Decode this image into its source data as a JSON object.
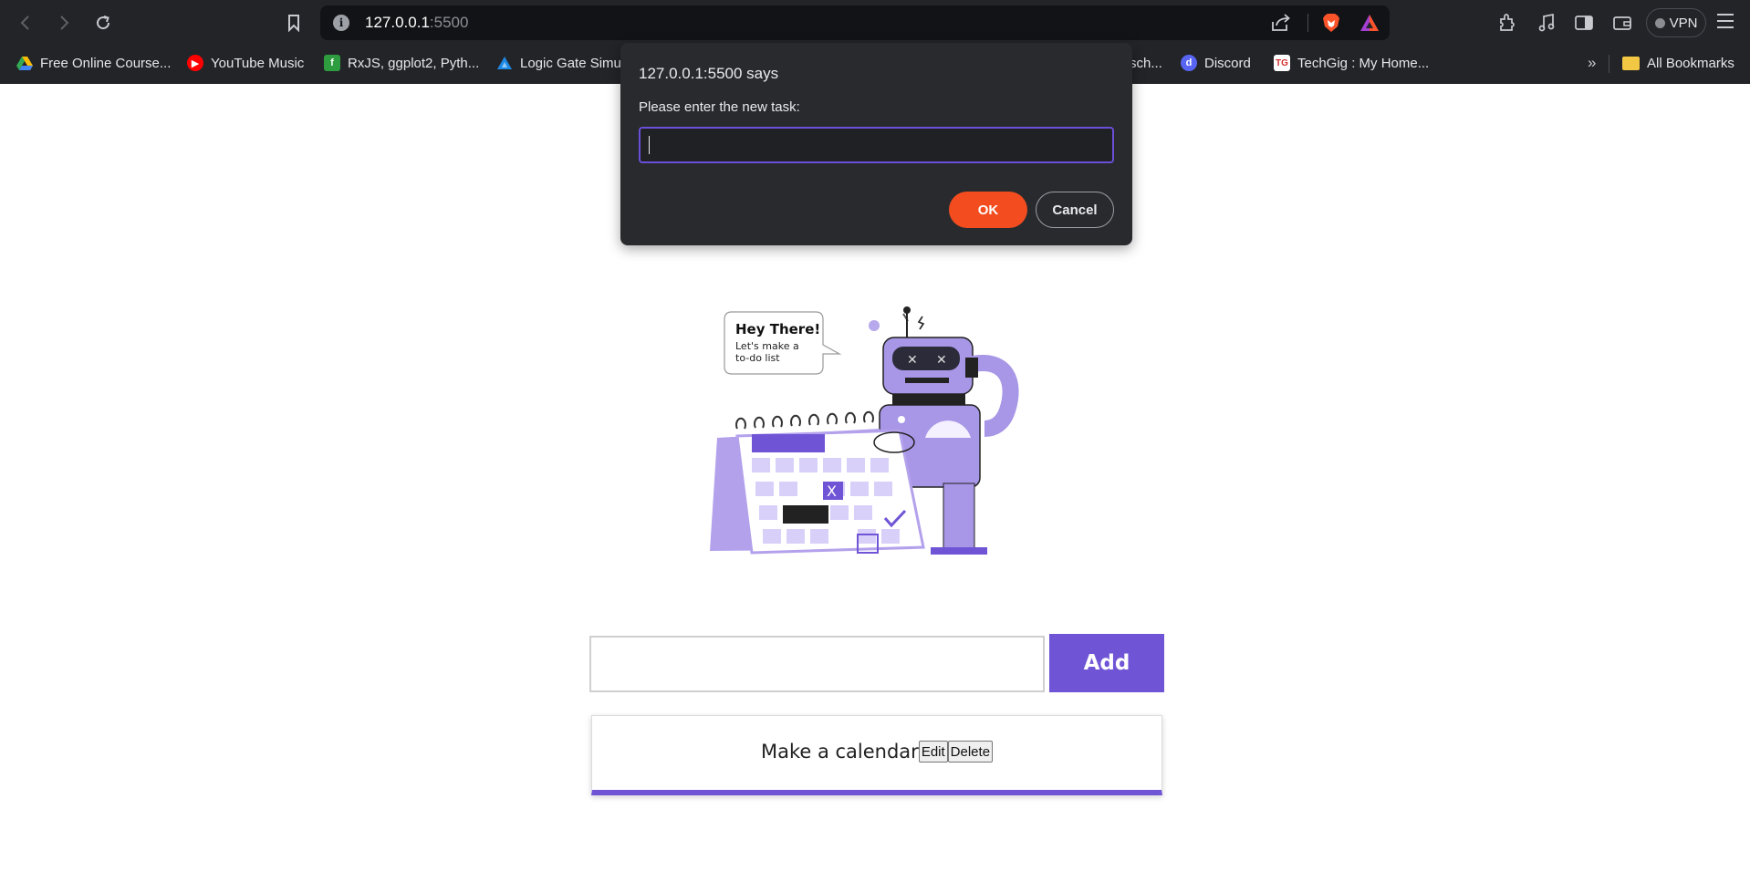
{
  "browser": {
    "url_host": "127.0.0.1",
    "url_port": ":5500",
    "vpn_label": "VPN",
    "bookmarks": [
      {
        "label": "Free Online Course...",
        "icon": "google-drive-icon",
        "color": "#34a853"
      },
      {
        "label": "YouTube Music",
        "icon": "youtube-music-icon",
        "color": "#ff0000"
      },
      {
        "label": "RxJS, ggplot2, Pyth...",
        "icon": "feed-icon",
        "color": "#2e9d3f"
      },
      {
        "label": "Logic Gate Simu",
        "icon": "logic-gate-icon",
        "color": "#1e88e5"
      },
      {
        "label": "sch...",
        "icon": "",
        "color": ""
      },
      {
        "label": "Discord",
        "icon": "discord-icon",
        "color": "#5865f2"
      },
      {
        "label": "TechGig : My Home...",
        "icon": "techgig-icon",
        "color": "#d32f2f"
      }
    ],
    "all_bookmarks_label": "All Bookmarks"
  },
  "dialog": {
    "title": "127.0.0.1:5500 says",
    "message": "Please enter the new task:",
    "input_value": "",
    "ok_label": "OK",
    "cancel_label": "Cancel"
  },
  "illustration": {
    "bubble_title": "Hey There!",
    "bubble_line1": "Let's make a",
    "bubble_line2": "to-do list"
  },
  "todo": {
    "input_value": "",
    "add_label": "Add",
    "tasks": [
      {
        "text": "Make a calendar",
        "edit_label": "Edit",
        "delete_label": "Delete"
      }
    ]
  },
  "colors": {
    "accent": "#6f54d6",
    "ok_button": "#f34d1f",
    "browser_chrome": "#232428"
  }
}
